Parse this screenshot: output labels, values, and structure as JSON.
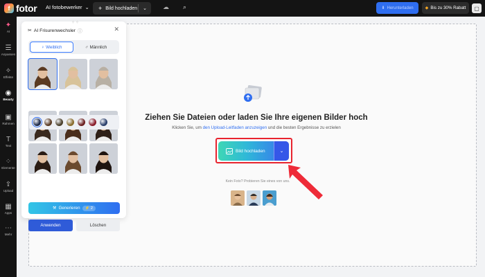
{
  "topbar": {
    "logo_mark": "f",
    "logo_text": "fotor",
    "mode_label": "AI fotobewerker",
    "mode_caret": "⌄",
    "upload_button": {
      "plus": "+",
      "label": "Bild hochladen",
      "caret": "⌄"
    },
    "cloud_icon": "☁",
    "search_icon": "⌕",
    "download_button": {
      "icon": "⬇",
      "label": "Herunterladen"
    },
    "promo": {
      "icon": "◆",
      "label": "Bis zu 30% Rabatt"
    },
    "account_icon": "▢"
  },
  "sidebar": {
    "items": [
      {
        "icon": "✦",
        "label": "AI"
      },
      {
        "icon": "☰",
        "label": "Anpassen"
      },
      {
        "icon": "✧",
        "label": "Effekte"
      },
      {
        "icon": "◉",
        "label": "Beauty"
      },
      {
        "icon": "▣",
        "label": "Rahmen"
      },
      {
        "icon": "T",
        "label": "Text"
      },
      {
        "icon": "⁘",
        "label": "Elemente"
      },
      {
        "icon": "⇪",
        "label": "Upload"
      },
      {
        "icon": "▦",
        "label": "Apps"
      },
      {
        "icon": "⋯",
        "label": "Mehr"
      }
    ],
    "active": "Beauty"
  },
  "panel": {
    "title": "AI Frisurenwechsler",
    "info_icon": "ⓘ",
    "close_icon": "✕",
    "gender_female": "Weiblich",
    "gender_male": "Männlich",
    "selected_gender": "Weiblich",
    "hairstyles_count": 9,
    "selected_hairstyle": 1,
    "hair_colors": [
      "#1d2a4a",
      "#5a3a22",
      "#4a3f2a",
      "#8a6d2e",
      "#6b1f1f",
      "#8a1d2a",
      "#2a3f6b"
    ],
    "selected_color": 1,
    "generate_label": "Generieren",
    "generate_credits": "2",
    "apply_label": "Anwenden",
    "clear_label": "Löschen"
  },
  "main": {
    "headline": "Ziehen Sie Dateien oder laden Sie Ihre eigenen Bilder hoch",
    "sub_before": "Klicken Sie, um ",
    "sub_link": "den Upload-Leitfaden anzuzeigen",
    "sub_after": " und die besten Ergebnisse zu erzielen",
    "upload_label": "Bild hochladen",
    "upload_caret": "⌄",
    "try_text": "Kein Foto? Probieren Sie eines von uns.",
    "sample_count": 3
  }
}
